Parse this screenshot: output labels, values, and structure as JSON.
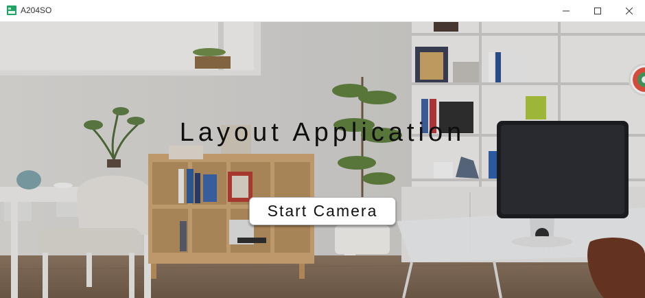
{
  "window": {
    "title": "A204SO",
    "icons": {
      "app": "app-icon",
      "minimize": "minimize-icon",
      "maximize": "maximize-icon",
      "close": "close-icon"
    }
  },
  "main": {
    "headline": "Layout Application",
    "start_button_label": "Start Camera"
  },
  "colors": {
    "accent_green": "#21a366",
    "headline": "#0e0e0e",
    "button_bg": "#ffffff"
  }
}
